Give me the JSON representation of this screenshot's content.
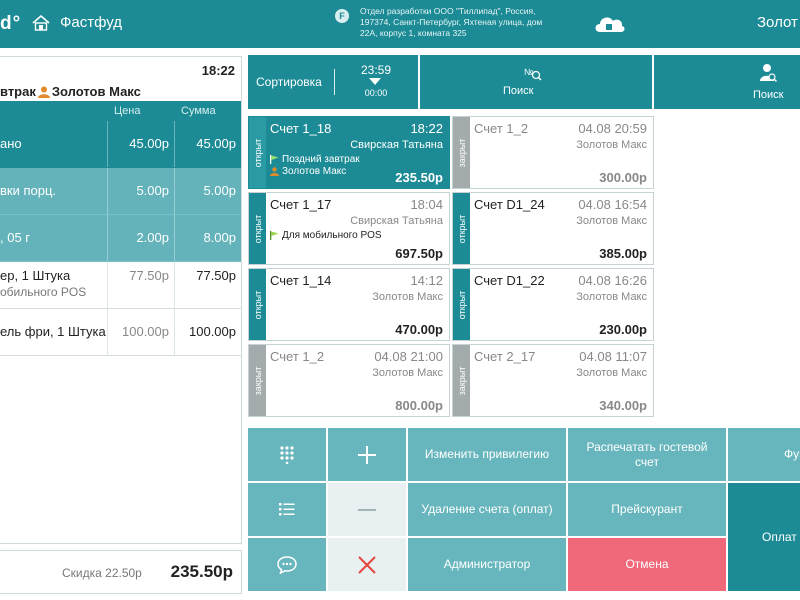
{
  "header": {
    "logo": "d°",
    "title": "Фастфуд",
    "badge": "F",
    "org_line1": "Отдел разработки ООО \"Тиллипад\", Россия,",
    "org_line2": "197374, Санкт-Петербург, Яхтеная улица, дом",
    "org_line3": "22А, корпус 1, комната 325",
    "user": "Золот"
  },
  "order": {
    "time": "18:22",
    "title_left": "втрак",
    "waiter": "Золотов Макс",
    "col_price": "Цена",
    "col_sum": "Сумма",
    "items": [
      {
        "name": "ано",
        "sub": "",
        "price": "45.00р",
        "sum": "45.00р",
        "style": "dark"
      },
      {
        "name": "вки порц.",
        "sub": "",
        "price": "5.00р",
        "sum": "5.00р",
        "style": "light"
      },
      {
        "name": ", 05 г",
        "sub": "",
        "price": "2.00р",
        "sum": "8.00р",
        "style": "light"
      },
      {
        "name": "ер, 1 Штука",
        "sub": "обильного POS",
        "price": "77.50р",
        "sum": "77.50р",
        "style": "plain"
      },
      {
        "name": "ель фри, 1 Штука",
        "sub": "",
        "price": "100.00р",
        "sum": "100.00р",
        "style": "plain"
      }
    ],
    "discount": "Скидка 22.50р",
    "total": "235.50р"
  },
  "toolbar": {
    "sort": "Сортировка",
    "time_top": "23:59",
    "time_bottom": "00:00",
    "search1": "Поиск",
    "search2": "Поиск"
  },
  "cards": [
    {
      "name": "Счет 1_18",
      "time": "18:22",
      "waiter": "Свирская Татьяна",
      "tag1": "Поздний завтрак",
      "tag2": "Золотов Макс",
      "amount": "235.50р",
      "status": "открыт",
      "state": "sel"
    },
    {
      "name": "Счет 1_2",
      "time": "04.08 20:59",
      "waiter": "Золотов Макс",
      "tag1": "",
      "tag2": "",
      "amount": "300.00р",
      "status": "закрыт",
      "state": "closed"
    },
    {
      "name": "Счет 1_17",
      "time": "18:04",
      "waiter": "Свирская Татьяна",
      "tag1": "Для мобильного POS",
      "tag2": "",
      "amount": "697.50р",
      "status": "открыт",
      "state": "open"
    },
    {
      "name": "Счет D1_24",
      "time": "04.08 16:54",
      "waiter": "Золотов Макс",
      "tag1": "",
      "tag2": "",
      "amount": "385.00р",
      "status": "открыт",
      "state": "open"
    },
    {
      "name": "Счет 1_14",
      "time": "14:12",
      "waiter": "Золотов Макс",
      "tag1": "",
      "tag2": "",
      "amount": "470.00р",
      "status": "открыт",
      "state": "open"
    },
    {
      "name": "Счет D1_22",
      "time": "04.08 16:26",
      "waiter": "Золотов Макс",
      "tag1": "",
      "tag2": "",
      "amount": "230.00р",
      "status": "открыт",
      "state": "open"
    },
    {
      "name": "Счет 1_2",
      "time": "04.08 21:00",
      "waiter": "Золотов Макс",
      "tag1": "",
      "tag2": "",
      "amount": "800.00р",
      "status": "закрыт",
      "state": "closed"
    },
    {
      "name": "Счет 2_17",
      "time": "04.08 11:07",
      "waiter": "Золотов Макс",
      "tag1": "",
      "tag2": "",
      "amount": "340.00р",
      "status": "закрыт",
      "state": "closed"
    }
  ],
  "actions": {
    "change_privilege": "Изменить привилегию",
    "print_guest": "Распечатать гостевой счет",
    "func": "Фун",
    "delete_bill": "Удаление счета (оплат)",
    "price_list": "Прейскурант",
    "pay": "Оплат",
    "admin": "Администратор",
    "cancel": "Отмена"
  },
  "colors": {
    "teal": "#1c8b95",
    "teal_light": "#68b6bd",
    "red": "#f0697a",
    "grey_strip": "#a3abac"
  }
}
